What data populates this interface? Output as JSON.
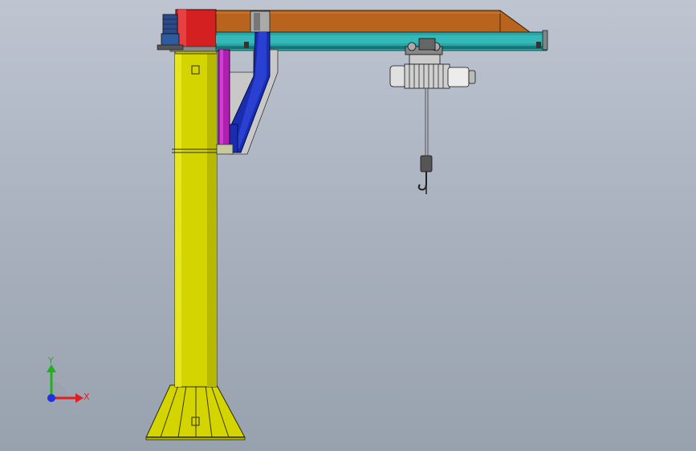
{
  "viewport": {
    "background_top": "#bec5d1",
    "background_bottom": "#98a1ae"
  },
  "triad": {
    "x_label": "X",
    "y_label": "Y",
    "x_color": "#e02020",
    "y_color": "#20b020",
    "z_color": "#2030e0"
  },
  "model": {
    "column_color": "#d4d400",
    "boom_top_color": "#b8641e",
    "boom_bottom_color": "#2aa6a6",
    "bracket_color": "#1a2db0",
    "slew_ring_color": "#d42020",
    "side_plate_color": "#b020b0"
  }
}
